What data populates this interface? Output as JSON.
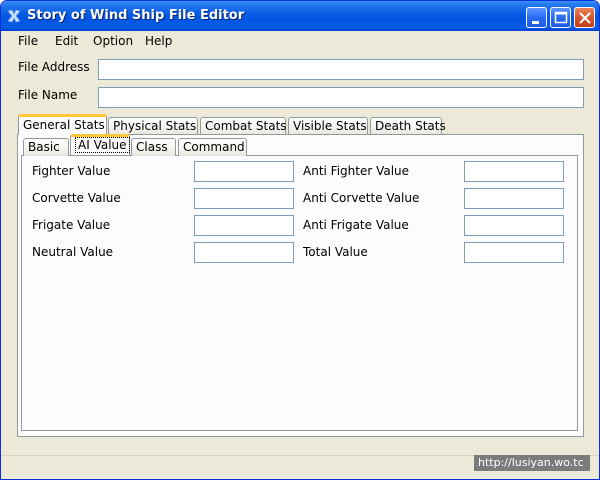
{
  "window": {
    "title": "Story of Wind Ship File Editor",
    "colors": {
      "titlebar": "#0054e3",
      "tab_highlight": "#ffc83c",
      "face": "#ece9d8"
    }
  },
  "menu": [
    "File",
    "Edit",
    "Option",
    "Help"
  ],
  "fields": {
    "file_address_label": "File Address",
    "file_address_value": "",
    "file_name_label": "File Name",
    "file_name_value": ""
  },
  "tabs": [
    "General Stats",
    "Physical Stats",
    "Combat Stats",
    "Visible Stats",
    "Death Stats"
  ],
  "subtabs": [
    "Basic",
    "AI Value",
    "Class",
    "Command"
  ],
  "ai_values": {
    "left": [
      {
        "label": "Fighter Value",
        "value": ""
      },
      {
        "label": "Corvette Value",
        "value": ""
      },
      {
        "label": "Frigate Value",
        "value": ""
      },
      {
        "label": "Neutral Value",
        "value": ""
      }
    ],
    "right": [
      {
        "label": "Anti Fighter Value",
        "value": ""
      },
      {
        "label": "Anti Corvette Value",
        "value": ""
      },
      {
        "label": "Anti Frigate Value",
        "value": ""
      },
      {
        "label": "Total Value",
        "value": ""
      }
    ]
  },
  "status": {
    "watermark": "http://lusiyan.wo.tc"
  },
  "icons": {
    "app": "x-icon",
    "minimize": "minimize-icon",
    "maximize": "maximize-icon",
    "close": "close-icon"
  }
}
